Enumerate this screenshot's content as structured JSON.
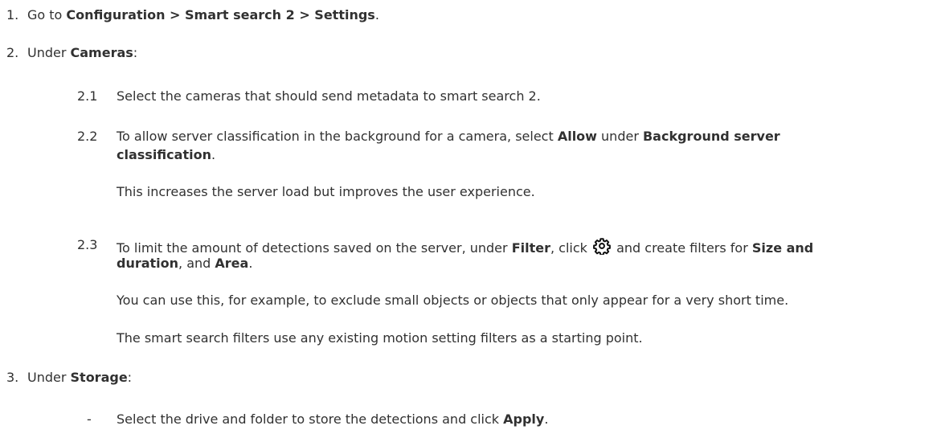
{
  "steps": [
    {
      "number": "1.",
      "parts": [
        "Go to ",
        "Configuration > Smart search 2 > Settings",
        "."
      ]
    },
    {
      "number": "2.",
      "parts": [
        "Under ",
        "Cameras",
        ":"
      ],
      "substeps": [
        {
          "number": "2.1",
          "text": "Select the cameras that should send metadata to smart search 2."
        },
        {
          "number": "2.2",
          "line1": [
            "To allow server classification in the background for a camera, select ",
            "Allow",
            " under ",
            "Background server"
          ],
          "line2": [
            "classification",
            "."
          ],
          "note": "This increases the server load but improves the user experience."
        },
        {
          "number": "2.3",
          "line1": [
            "To limit the amount of detections saved on the server, under ",
            "Filter",
            ", click ",
            " and create filters for ",
            "Size and"
          ],
          "line2": [
            "duration",
            ", and ",
            "Area",
            "."
          ],
          "icon": "gear-icon",
          "notes": [
            "You can use this, for example, to exclude small objects or objects that only appear for a very short time.",
            "The smart search filters use any existing motion setting filters as a starting point."
          ]
        }
      ]
    },
    {
      "number": "3.",
      "parts": [
        "Under ",
        "Storage",
        ":"
      ],
      "bullets": [
        {
          "marker": "-",
          "parts": [
            "Select the drive and folder to store the detections and click ",
            "Apply",
            "."
          ]
        }
      ]
    }
  ]
}
